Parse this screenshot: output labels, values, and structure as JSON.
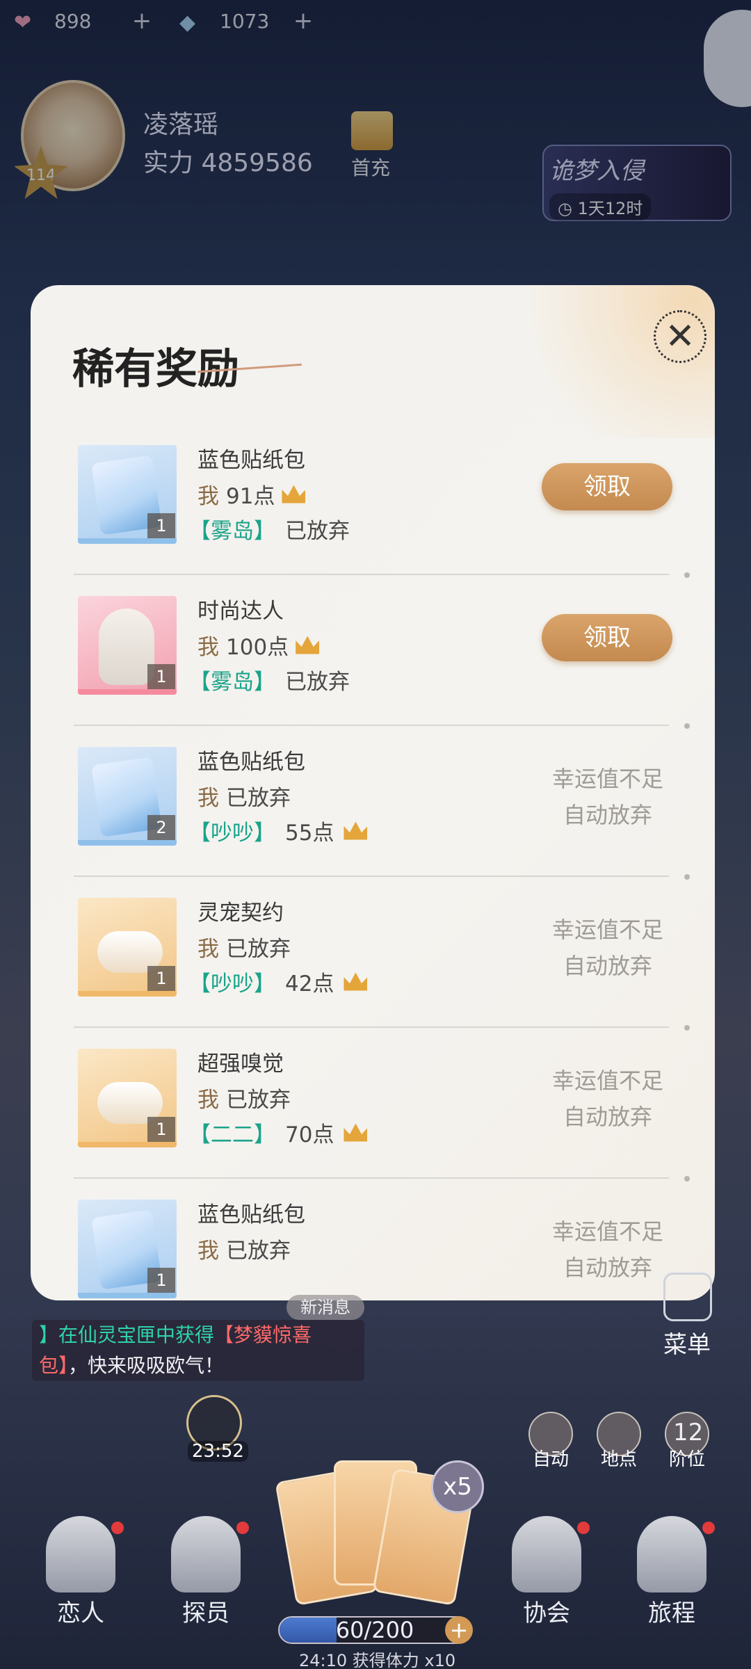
{
  "hud": {
    "hearts": "898",
    "gems": "1073",
    "player_name": "凌落瑶",
    "power": "实力 4859586",
    "level": "114",
    "first_recharge": "首充",
    "event_title": "诡梦入侵",
    "event_timer": "1天12时"
  },
  "modal": {
    "title": "稀有奖励",
    "claim_label": "领取",
    "forfeit_note": [
      "幸运值不足",
      "自动放弃"
    ],
    "items": [
      {
        "name": "蓝色贴纸包",
        "thumb": "blue",
        "qty": "1",
        "me_prefix": "我",
        "me_value": "91点",
        "me_crown": true,
        "guild_tag": "【雾岛】",
        "guild_value": "已放弃",
        "guild_crown": false,
        "status": "claim"
      },
      {
        "name": "时尚达人",
        "thumb": "pink",
        "qty": "1",
        "me_prefix": "我",
        "me_value": "100点",
        "me_crown": true,
        "guild_tag": "【雾岛】",
        "guild_value": "已放弃",
        "guild_crown": false,
        "status": "claim"
      },
      {
        "name": "蓝色贴纸包",
        "thumb": "blue",
        "qty": "2",
        "me_prefix": "我",
        "me_value": "已放弃",
        "me_crown": false,
        "guild_tag": "【吵吵】",
        "guild_value": "55点",
        "guild_crown": true,
        "status": "forfeit"
      },
      {
        "name": "灵宠契约",
        "thumb": "peach",
        "qty": "1",
        "me_prefix": "我",
        "me_value": "已放弃",
        "me_crown": false,
        "guild_tag": "【吵吵】",
        "guild_value": "42点",
        "guild_crown": true,
        "status": "forfeit"
      },
      {
        "name": "超强嗅觉",
        "thumb": "peach",
        "qty": "1",
        "me_prefix": "我",
        "me_value": "已放弃",
        "me_crown": false,
        "guild_tag": "【二二】",
        "guild_value": "70点",
        "guild_crown": true,
        "status": "forfeit"
      },
      {
        "name": "蓝色贴纸包",
        "thumb": "blue",
        "qty": "1",
        "me_prefix": "我",
        "me_value": "已放弃",
        "me_crown": false,
        "guild_tag": "",
        "guild_value": "",
        "guild_crown": false,
        "status": "forfeit"
      }
    ]
  },
  "chat": {
    "new_message": "新消息",
    "prefix": "】在仙灵宝匣中获得",
    "item": "【梦貘惊喜包】",
    "suffix": "，快来吸吸欧气！"
  },
  "controls": {
    "menu": "菜单",
    "timer": "23:52",
    "auto": "自动",
    "location": "地点",
    "tier_num": "12",
    "tier": "阶位",
    "multiplier": "x5"
  },
  "nav": {
    "lover": "恋人",
    "agent": "探员",
    "guild": "协会",
    "journey": "旅程"
  },
  "stamina": {
    "text": "60/200",
    "fraction": 0.3,
    "info": "24:10  获得体力  x10"
  },
  "colors": {
    "claim_button": "#c48a50",
    "guild_tag": "#1aa38a",
    "crown": "#e4a53a",
    "chat_highlight": "#ff6a6a"
  }
}
